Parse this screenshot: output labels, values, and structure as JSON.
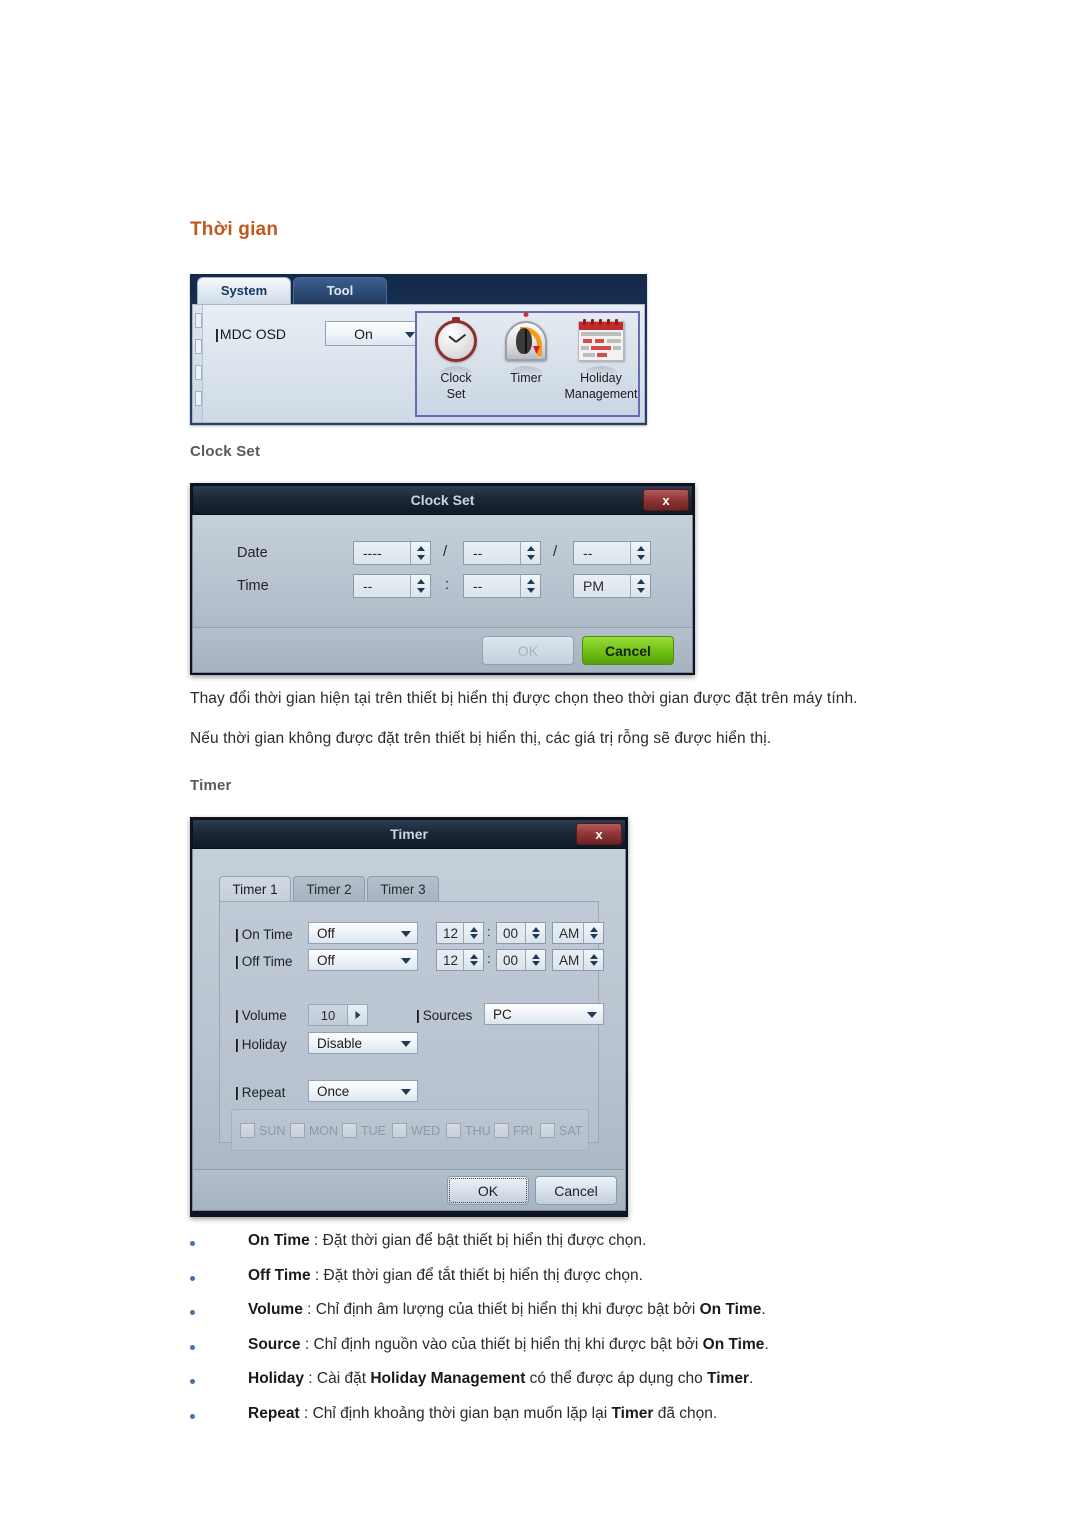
{
  "page": {
    "heading": "Thời gian",
    "sections": [
      {
        "label": "Clock Set"
      },
      {
        "label": "Timer"
      }
    ],
    "paragraphs": [
      "Thay đổi thời gian hiện tại trên thiết bị hiển thị được chọn theo thời gian được đặt trên máy tính.",
      "Nếu thời gian không được đặt trên thiết bị hiển thị, các giá trị rỗng sẽ được hiển thị."
    ]
  },
  "toolbar": {
    "tabs": [
      {
        "label": "System",
        "active": true
      },
      {
        "label": "Tool",
        "active": false
      }
    ],
    "osd": {
      "label": "MDC OSD",
      "value": "On"
    },
    "icons": [
      {
        "name": "clock-set-icon",
        "caption_line1": "Clock",
        "caption_line2": "Set"
      },
      {
        "name": "timer-icon",
        "caption_line1": "Timer",
        "caption_line2": ""
      },
      {
        "name": "holiday-management-icon",
        "caption_line1": "Holiday",
        "caption_line2": "Management"
      }
    ]
  },
  "clock_set_dialog": {
    "title": "Clock Set",
    "close_label": "x",
    "rows": [
      {
        "label": "Date",
        "fields": [
          "----",
          "--",
          "--"
        ],
        "separators": [
          "/",
          "/"
        ]
      },
      {
        "label": "Time",
        "fields": [
          "--",
          "--",
          "PM"
        ],
        "separators": [
          ":",
          ""
        ]
      }
    ],
    "buttons": {
      "ok": "OK",
      "cancel": "Cancel"
    }
  },
  "timer_dialog": {
    "title": "Timer",
    "close_label": "x",
    "tabs": [
      {
        "label": "Timer 1",
        "active": true
      },
      {
        "label": "Timer 2",
        "active": false
      },
      {
        "label": "Timer 3",
        "active": false
      }
    ],
    "on_time": {
      "label": "On Time",
      "mode": "Off",
      "hour": "12",
      "minute": "00",
      "meridiem": "AM",
      "separator": ":"
    },
    "off_time": {
      "label": "Off Time",
      "mode": "Off",
      "hour": "12",
      "minute": "00",
      "meridiem": "AM",
      "separator": ":"
    },
    "volume": {
      "label": "Volume",
      "value": "10"
    },
    "sources": {
      "label": "Sources",
      "value": "PC"
    },
    "holiday": {
      "label": "Holiday",
      "value": "Disable"
    },
    "repeat": {
      "label": "Repeat",
      "value": "Once"
    },
    "days": [
      {
        "label": "SUN",
        "checked": false
      },
      {
        "label": "MON",
        "checked": false
      },
      {
        "label": "TUE",
        "checked": false
      },
      {
        "label": "WED",
        "checked": false
      },
      {
        "label": "THU",
        "checked": false
      },
      {
        "label": "FRI",
        "checked": false
      },
      {
        "label": "SAT",
        "checked": false
      }
    ],
    "buttons": {
      "ok": "OK",
      "cancel": "Cancel"
    }
  },
  "bullets": [
    {
      "term": "On Time",
      "sep": " : ",
      "rest_1": "Đặt thời gian để bật thiết bị hiển thị được chọn.",
      "term_2": "",
      "rest_2": ""
    },
    {
      "term": "Off Time",
      "sep": " : ",
      "rest_1": "Đặt thời gian để tắt thiết bị hiển thị được chọn.",
      "term_2": "",
      "rest_2": ""
    },
    {
      "term": "Volume",
      "sep": " : ",
      "rest_1": "Chỉ định âm lượng của thiết bị hiển thị khi được bật bởi ",
      "term_2": "On Time",
      "rest_2": "."
    },
    {
      "term": "Source",
      "sep": " : ",
      "rest_1": "Chỉ định nguồn vào của thiết bị hiển thị khi được bật bởi ",
      "term_2": "On Time",
      "rest_2": "."
    },
    {
      "term": "Holiday",
      "sep": " : ",
      "rest_1": "Cài đặt ",
      "term_2": "Holiday Management",
      "rest_2": " có thể được áp dụng cho ",
      "term_3": "Timer",
      "rest_3": "."
    },
    {
      "term": "Repeat",
      "sep": " : ",
      "rest_1": "Chỉ định khoảng thời gian bạn muốn lặp lại ",
      "term_2": "Timer",
      "rest_2": " đã chọn."
    }
  ],
  "colors": {
    "heading": "#c1591f",
    "subheading": "#58595b",
    "bullet_dot": "#4472a8",
    "icon_box_border": "#6e68b4",
    "cancel_green": "#6fbf14",
    "close_red": "#8f3535"
  }
}
